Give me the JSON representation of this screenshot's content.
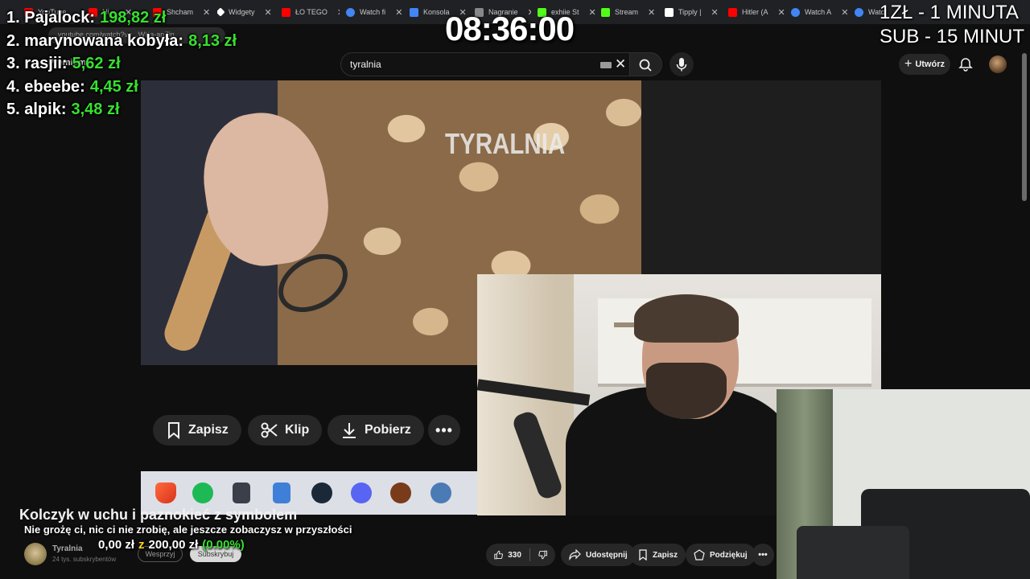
{
  "browser": {
    "tabs": [
      {
        "label": "YouTube",
        "color": "#ff0000"
      },
      {
        "label": "Ni...",
        "color": "#ff0000"
      },
      {
        "label": "Shcham",
        "color": "#ff0000"
      },
      {
        "label": "Widgety",
        "color": "#ffffff"
      },
      {
        "label": "ŁO TEGO",
        "color": "#ff0000"
      },
      {
        "label": "Watch fi",
        "color": "#4285f4"
      },
      {
        "label": "Konsola",
        "color": "#4285f4"
      },
      {
        "label": "Nagranie",
        "color": "#888888"
      },
      {
        "label": "exhiie St",
        "color": "#53fc18"
      },
      {
        "label": "Stream",
        "color": "#53fc18"
      },
      {
        "label": "Tipply |",
        "color": "#ffffff"
      },
      {
        "label": "Hitler (A",
        "color": "#ff0000"
      },
      {
        "label": "Watch A",
        "color": "#4285f4"
      },
      {
        "label": "Watch",
        "color": "#4285f4"
      }
    ],
    "url": "youtube.com/watch?v=...WKa-apZin"
  },
  "youtube": {
    "brand": "Premium",
    "search_value": "tyralnia",
    "create_label": "Utwórz",
    "video_watermark": "TYRALNIA",
    "player_actions": {
      "save": "Zapisz",
      "clip": "Klip",
      "download": "Pobierz"
    },
    "video_title": "Kolczyk w uchu i paznokieć z symbolem",
    "channel": {
      "name": "Tyralnia",
      "subscribers": "24 tys. subskrybentów",
      "join_label": "Wesprzyj",
      "subscribe_label": "Subskrybuj"
    },
    "actions": {
      "likes": "330",
      "share": "Udostępnij",
      "save": "Zapisz",
      "thanks": "Podziękuj"
    }
  },
  "overlay": {
    "leaderboard": [
      {
        "name": "1. Pajalock:",
        "amount": "198,82 zł"
      },
      {
        "name": "2. marynowana kobyła:",
        "amount": "8,13 zł"
      },
      {
        "name": "3. rasjii:",
        "amount": "5,62 zł"
      },
      {
        "name": "4. ebeebe:",
        "amount": "4,45 zł"
      },
      {
        "name": "5. alpik:",
        "amount": "3,48 zł"
      }
    ],
    "clock": "08:36:00",
    "rates_line1": "1ZŁ - 1 MINUTA",
    "rates_line2": "SUB - 15 MINUT",
    "subtitle": "Nie grożę ci, nic ci nie zrobię, ale jeszcze zobaczysz w przyszłości",
    "goal": {
      "current": "0,00 zł",
      "of": "z",
      "target": "200,00 zł",
      "percent": "(0.00%)"
    }
  }
}
